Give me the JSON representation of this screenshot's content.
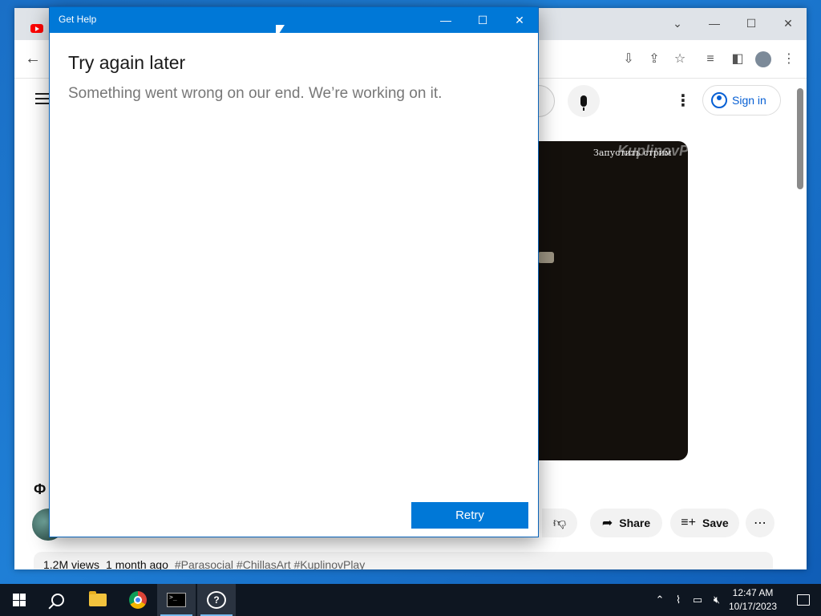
{
  "browser": {
    "window_controls": {
      "minimize": "—",
      "maximize": "☐",
      "close": "✕",
      "tab_list": "⌄"
    },
    "youtube": {
      "sign_in_label": "Sign in",
      "video_overlay_text": "Запустить стрим",
      "video_watermark": "KuplinovPlay",
      "title_fragment": "Ф",
      "actions": {
        "share": "Share",
        "save": "Save"
      },
      "meta": {
        "views": "1.2M views",
        "age": "1 month ago",
        "tags": "#Parasocial #ChillasArt #KuplinovPlay"
      }
    }
  },
  "get_help": {
    "title": "Get Help",
    "controls": {
      "minimize": "—",
      "maximize": "☐",
      "close": "✕"
    },
    "heading": "Try again later",
    "message": "Something went wrong on our end. We’re working on it.",
    "retry_label": "Retry"
  },
  "taskbar": {
    "clock_time": "12:47 AM",
    "clock_date": "10/17/2023",
    "terminal_glyph": ">_"
  },
  "colors": {
    "accent": "#0078d7",
    "youtube_red": "#ff0000",
    "youtube_link": "#065fd4",
    "taskbar_bg": "#0e1621"
  }
}
